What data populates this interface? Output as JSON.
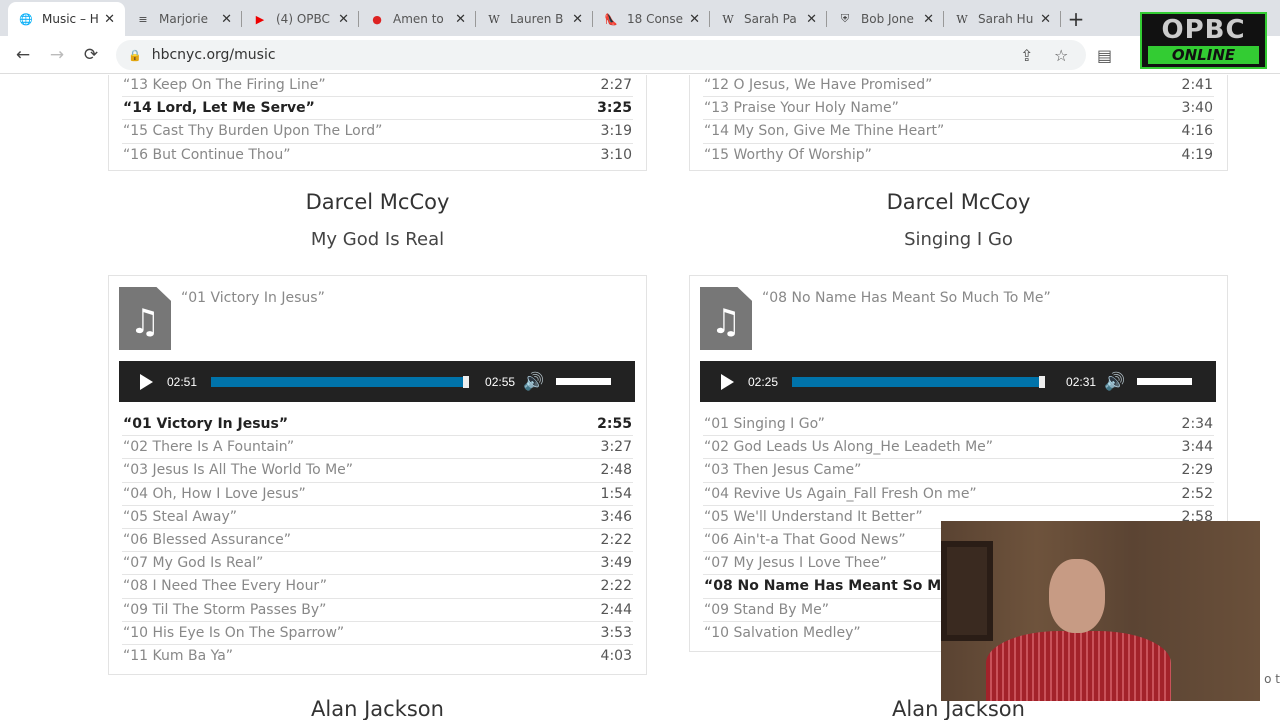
{
  "browser": {
    "tabs": [
      {
        "title": "Music – H",
        "icon": "globe-icon",
        "active": true
      },
      {
        "title": "Marjorie",
        "icon": "document-icon"
      },
      {
        "title": "(4) OPBC",
        "icon": "youtube-icon"
      },
      {
        "title": "Amen to",
        "icon": "red-circle-icon"
      },
      {
        "title": "Lauren B",
        "icon": "wikipedia-icon"
      },
      {
        "title": "18 Conse",
        "icon": "high-heel-icon"
      },
      {
        "title": "Sarah Pa",
        "icon": "wikipedia-icon"
      },
      {
        "title": "Bob Jone",
        "icon": "shield-icon"
      },
      {
        "title": "Sarah Hu",
        "icon": "wikipedia-icon"
      }
    ],
    "url": "hbcnyc.org/music",
    "logo_text": "OPBC ONLINE"
  },
  "top_left_tracks": [
    {
      "title": "“13 Keep On The Firing Line”",
      "duration": "2:27"
    },
    {
      "title": "“14 Lord, Let Me Serve”",
      "duration": "3:25",
      "current": true
    },
    {
      "title": "“15 Cast Thy Burden Upon The Lord”",
      "duration": "3:19"
    },
    {
      "title": "“16 But Continue Thou”",
      "duration": "3:10"
    }
  ],
  "top_right_tracks": [
    {
      "title": "“12 O Jesus, We Have Promised”",
      "duration": "2:41"
    },
    {
      "title": "“13 Praise Your Holy Name”",
      "duration": "3:40"
    },
    {
      "title": "“14 My Son, Give Me Thine Heart”",
      "duration": "4:16"
    },
    {
      "title": "“15 Worthy Of Worship”",
      "duration": "4:19"
    }
  ],
  "albums": [
    {
      "artist": "Darcel McCoy",
      "album": "My God Is Real",
      "now_playing": "“01 Victory In Jesus”",
      "elapsed": "02:51",
      "total": "02:55",
      "progress": 0.98,
      "tracks": [
        {
          "title": "“01 Victory In Jesus”",
          "duration": "2:55",
          "current": true
        },
        {
          "title": "“02 There Is A Fountain”",
          "duration": "3:27"
        },
        {
          "title": "“03 Jesus Is All The World To Me”",
          "duration": "2:48"
        },
        {
          "title": "“04 Oh, How I Love Jesus”",
          "duration": "1:54"
        },
        {
          "title": "“05 Steal Away”",
          "duration": "3:46"
        },
        {
          "title": "“06 Blessed Assurance”",
          "duration": "2:22"
        },
        {
          "title": "“07 My God Is Real”",
          "duration": "3:49"
        },
        {
          "title": "“08 I Need Thee Every Hour”",
          "duration": "2:22"
        },
        {
          "title": "“09 Til The Storm Passes By”",
          "duration": "2:44"
        },
        {
          "title": "“10 His Eye Is On The Sparrow”",
          "duration": "3:53"
        },
        {
          "title": "“11 Kum Ba Ya”",
          "duration": "4:03"
        }
      ]
    },
    {
      "artist": "Darcel McCoy",
      "album": "Singing I Go",
      "now_playing": "“08 No Name Has Meant So Much To Me”",
      "elapsed": "02:25",
      "total": "02:31",
      "progress": 0.96,
      "tracks": [
        {
          "title": "“01 Singing I Go”",
          "duration": "2:34"
        },
        {
          "title": "“02 God Leads Us Along_He Leadeth Me”",
          "duration": "3:44"
        },
        {
          "title": "“03 Then Jesus Came”",
          "duration": "2:29"
        },
        {
          "title": "“04 Revive Us Again_Fall Fresh On me”",
          "duration": "2:52"
        },
        {
          "title": "“05 We'll Understand It Better”",
          "duration": "2:58"
        },
        {
          "title": "“06 Ain't-a That Good News”",
          "duration": ""
        },
        {
          "title": "“07 My Jesus I Love Thee”",
          "duration": ""
        },
        {
          "title": "“08 No Name Has Meant So Much To Me”",
          "duration": "",
          "current": true
        },
        {
          "title": "“09 Stand By Me”",
          "duration": ""
        },
        {
          "title": "“10 Salvation Medley”",
          "duration": ""
        }
      ]
    }
  ],
  "next_artists": [
    "Alan Jackson",
    "Alan Jackson"
  ],
  "edge_text": "o t"
}
